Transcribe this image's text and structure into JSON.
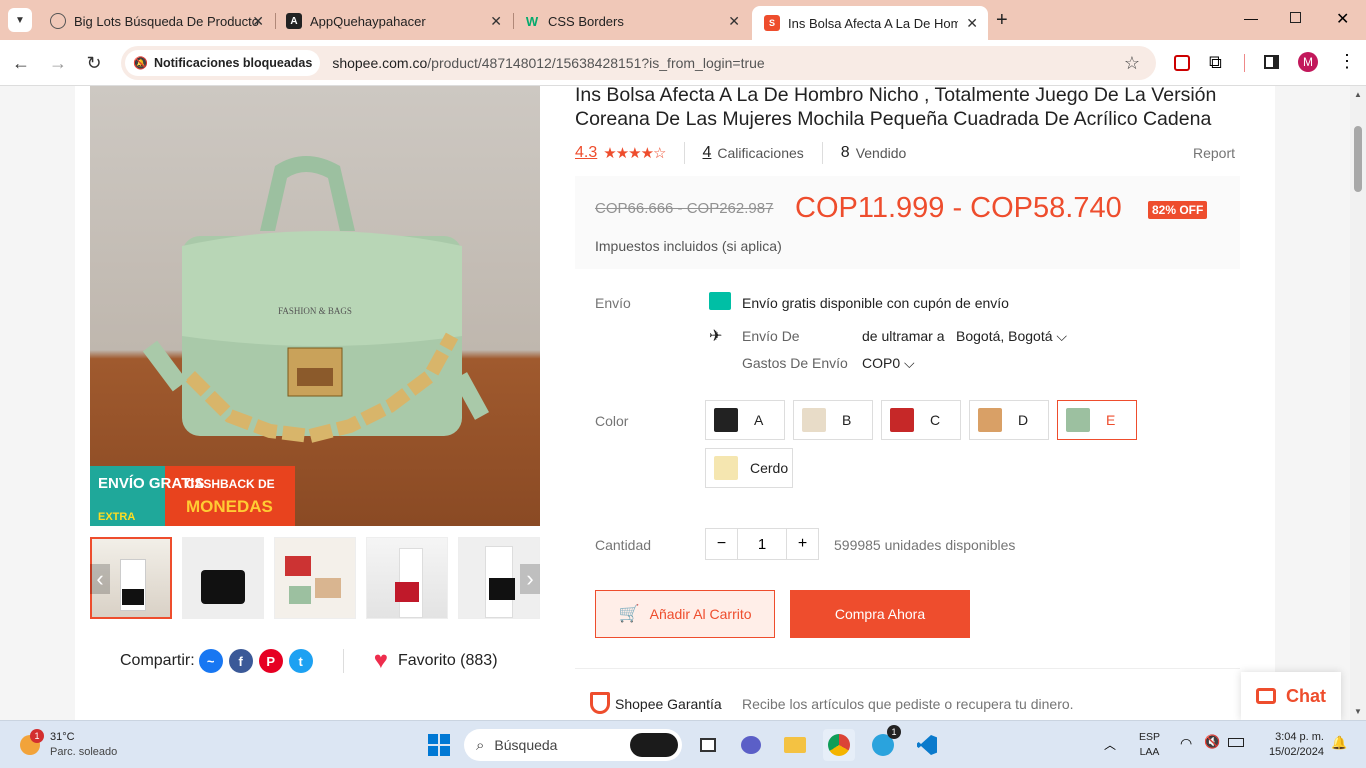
{
  "browser": {
    "tabs": [
      {
        "title": "Big Lots Búsqueda De Producto",
        "icon": "globe-icon",
        "active": false
      },
      {
        "title": "AppQuehaypahacer",
        "icon": "angular-icon",
        "active": false
      },
      {
        "title": "CSS Borders",
        "icon": "w3schools-icon",
        "active": false
      },
      {
        "title": "Ins Bolsa Afecta A La De Hombr",
        "icon": "shopee-icon",
        "active": true
      }
    ],
    "notification_chip": "Notificaciones bloqueadas",
    "url_domain": "shopee.com.co",
    "url_path": "/product/487148012/15638428151?is_from_login=true",
    "profile_initial": "M"
  },
  "product": {
    "title": "Ins Bolsa Afecta A La De Hombro Nicho , Totalmente Juego De La Versión Coreana De Las Mujeres Mochila Pequeña Cuadrada De Acrílico Cadena",
    "rating": "4.3",
    "ratings_count": "4",
    "ratings_label": "Calificaciones",
    "sold_count": "8",
    "sold_label": "Vendido",
    "report": "Report",
    "original_price": "COP66.666 - COP262.987",
    "price": "COP11.999 - COP58.740",
    "discount_badge": "82% OFF",
    "tax_note": "Impuestos incluidos (si aplica)",
    "image_banner_free": "ENVÍO GRATIS",
    "image_banner_extra": "EXTRA",
    "image_banner_cashback": "CASHBACK DE",
    "image_banner_coins": "MONEDAS",
    "bag_text": "FASHION & BAGS"
  },
  "shipping": {
    "label": "Envío",
    "free_text": "Envío gratis disponible con cupón de envío",
    "from_label": "Envío De",
    "from_value": "de ultramar a",
    "to_value": "Bogotá, Bogotá",
    "cost_label": "Gastos De Envío",
    "cost_value": "COP0"
  },
  "variants": {
    "label": "Color",
    "options": [
      "A",
      "B",
      "C",
      "D",
      "E",
      "Cerdo"
    ],
    "selected": "E"
  },
  "quantity": {
    "label": "Cantidad",
    "value": "1",
    "minus": "−",
    "plus": "+",
    "available": "599985 unidades disponibles"
  },
  "actions": {
    "add_to_cart": "Añadir Al Carrito",
    "buy_now": "Compra Ahora"
  },
  "share": {
    "label": "Compartir:",
    "favorite": "Favorito (883)"
  },
  "guarantee": {
    "title": "Shopee Garantía",
    "text": "Recibe los artículos que pediste o recupera tu dinero."
  },
  "chat": {
    "label": "Chat"
  },
  "taskbar": {
    "weather_temp": "31°C",
    "weather_desc": "Parc. soleado",
    "weather_badge": "1",
    "search_placeholder": "Búsqueda",
    "lang_top": "ESP",
    "lang_bottom": "LAA",
    "time": "3:04 p. m.",
    "date": "15/02/2024",
    "telegram_badge": "1"
  },
  "colors": {
    "accent": "#ee4d2d",
    "chrome_tab_bg": "#f0c8b8",
    "taskbar_bg": "#dce6f3"
  }
}
